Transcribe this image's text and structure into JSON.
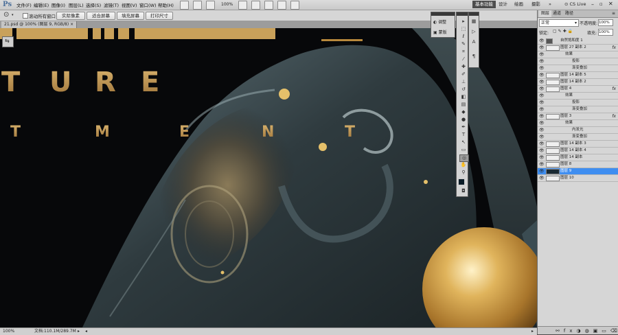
{
  "app": {
    "logo": "Ps"
  },
  "menu": [
    "文件(F)",
    "编辑(E)",
    "图像(I)",
    "图层(L)",
    "选择(S)",
    "滤镜(T)",
    "视图(V)",
    "窗口(W)",
    "帮助(H)"
  ],
  "app_bar": {
    "zoom": "100%",
    "workspaces": [
      "基本功能",
      "设计",
      "绘画",
      "摄影"
    ],
    "more": "»",
    "cs_live": "CS Live"
  },
  "options_bar": {
    "scroll_all_windows": "滚动所有窗口",
    "buttons": [
      "实际像素",
      "适合屏幕",
      "填充屏幕",
      "打印尺寸"
    ]
  },
  "document": {
    "tab_title": "21.psd @ 100% (图层 9, RGB/8)"
  },
  "artwork": {
    "letters_row1": [
      "T",
      "U",
      "R",
      "E"
    ],
    "letters_row2": [
      "T",
      "M",
      "E",
      "N",
      "T"
    ]
  },
  "status": {
    "zoom": "100%",
    "doc_size": "文档:110.1M/289.7M"
  },
  "adjust_panel": {
    "items": [
      "调整",
      "蒙版"
    ]
  },
  "colors": {
    "accent_gold": "#c9a15a",
    "selection_blue": "#3f8ef0",
    "panel_bg": "#d6d6d6"
  },
  "layers_panel": {
    "tabs": [
      "图层",
      "通道",
      "路径"
    ],
    "blend_mode": "正常",
    "opacity_label": "不透明度:",
    "opacity": "100%",
    "lock_label": "锁定:",
    "fill_label": "填充:",
    "fill": "100%",
    "rows": [
      {
        "name": "自然饱和度 1",
        "kind": "adj"
      },
      {
        "name": "图层 27 副本 2",
        "fx": "fx"
      },
      {
        "name": "效果",
        "kind": "fxhead"
      },
      {
        "name": "投影",
        "kind": "fxsub"
      },
      {
        "name": "渐变叠加",
        "kind": "fxsub"
      },
      {
        "name": "图层 14 副本 5"
      },
      {
        "name": "图层 14 副本 2"
      },
      {
        "name": "图层 4",
        "fx": "fx"
      },
      {
        "name": "效果",
        "kind": "fxhead"
      },
      {
        "name": "投影",
        "kind": "fxsub"
      },
      {
        "name": "渐变叠加",
        "kind": "fxsub"
      },
      {
        "name": "图层 3",
        "fx": "fx"
      },
      {
        "name": "效果",
        "kind": "fxhead"
      },
      {
        "name": "内发光",
        "kind": "fxsub"
      },
      {
        "name": "渐变叠加",
        "kind": "fxsub"
      },
      {
        "name": "图层 14 副本 3"
      },
      {
        "name": "图层 14 副本 4"
      },
      {
        "name": "图层 14 副本"
      },
      {
        "name": "图层 8"
      },
      {
        "name": "图层 9",
        "selected": true
      },
      {
        "name": "图层 10"
      }
    ]
  }
}
